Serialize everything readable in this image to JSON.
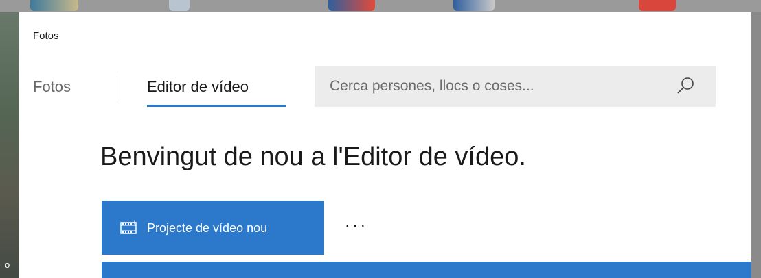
{
  "app": {
    "title": "Fotos"
  },
  "nav": {
    "tabs": [
      {
        "label": "Fotos",
        "selected": false
      },
      {
        "label": "Editor de vídeo",
        "selected": true
      }
    ]
  },
  "search": {
    "placeholder": "Cerca persones, llocs o coses..."
  },
  "main": {
    "heading": "Benvingut de nou a l'Editor de vídeo.",
    "new_project_label": "Projecte de vídeo nou",
    "more_label": "···"
  },
  "desktop": {
    "left_label": "o"
  },
  "colors": {
    "accent": "#2c79cb",
    "search_bg": "#ececec",
    "frame": "#7f7f7f"
  },
  "icons": {
    "search": "search-icon",
    "new_project": "video-project-icon"
  }
}
